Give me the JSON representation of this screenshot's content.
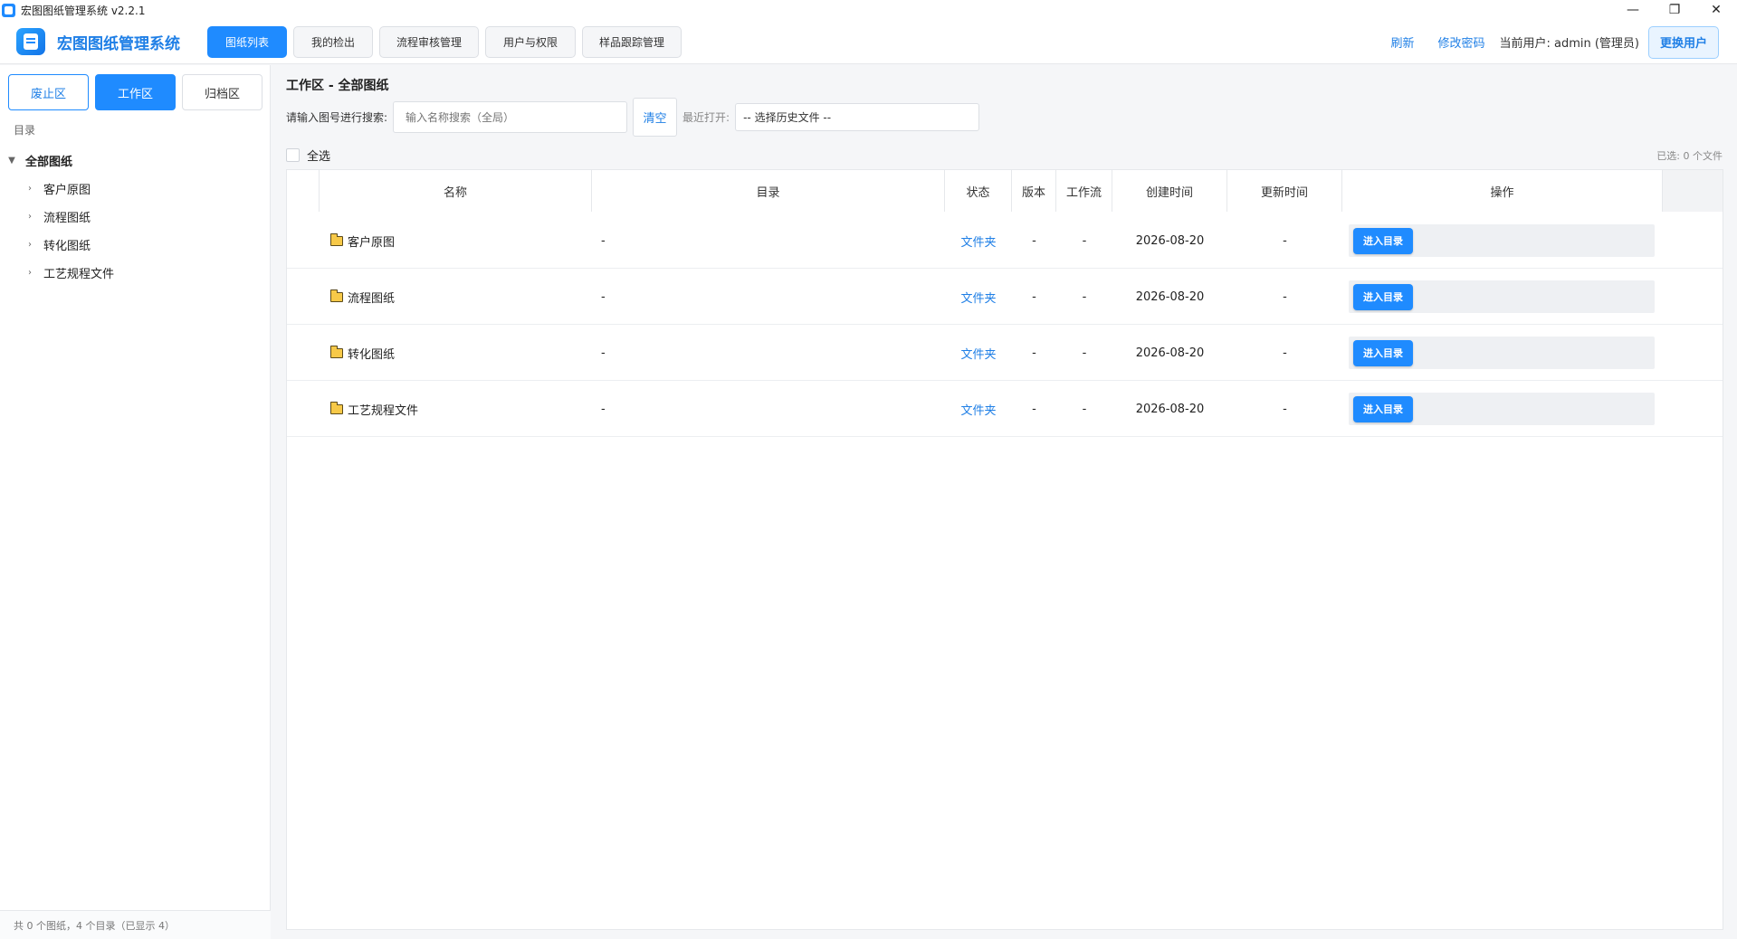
{
  "window": {
    "title": "宏图图纸管理系统  v2.2.1",
    "controls": {
      "minimize": "—",
      "restore": "❐",
      "close": "✕"
    }
  },
  "header": {
    "brand": "宏图图纸管理系统",
    "nav": [
      {
        "label": "图纸列表",
        "active": true
      },
      {
        "label": "我的检出",
        "active": false
      },
      {
        "label": "流程审核管理",
        "active": false
      },
      {
        "label": "用户与权限",
        "active": false
      },
      {
        "label": "样品跟踪管理",
        "active": false
      }
    ],
    "refresh": "刷新",
    "change_password": "修改密码",
    "current_user": "当前用户: admin (管理员)",
    "switch_user": "更换用户"
  },
  "sidebar": {
    "zones": [
      "废止区",
      "工作区",
      "归档区"
    ],
    "section_label": "目录",
    "tree": {
      "root": "全部图纸",
      "children": [
        "客户原图",
        "流程图纸",
        "转化图纸",
        "工艺规程文件"
      ]
    },
    "footer": "共 0 个图纸，4 个目录（已显示 4）"
  },
  "main": {
    "title": "工作区 - 全部图纸",
    "search_label": "请输入图号进行搜索:",
    "search_placeholder": "输入名称搜索（全局）",
    "clear": "清空",
    "recent_label": "最近打开:",
    "recent_value": "-- 选择历史文件 --",
    "select_all": "全选",
    "selected_count": "已选: 0 个文件",
    "columns": [
      "名称",
      "目录",
      "状态",
      "版本",
      "工作流",
      "创建时间",
      "更新时间",
      "操作"
    ],
    "rows": [
      {
        "name": "客户原图",
        "dir": "-",
        "status": "文件夹",
        "version": "-",
        "workflow": "-",
        "created": "2026-08-20",
        "updated": "-",
        "action": "进入目录"
      },
      {
        "name": "流程图纸",
        "dir": "-",
        "status": "文件夹",
        "version": "-",
        "workflow": "-",
        "created": "2026-08-20",
        "updated": "-",
        "action": "进入目录"
      },
      {
        "name": "转化图纸",
        "dir": "-",
        "status": "文件夹",
        "version": "-",
        "workflow": "-",
        "created": "2026-08-20",
        "updated": "-",
        "action": "进入目录"
      },
      {
        "name": "工艺规程文件",
        "dir": "-",
        "status": "文件夹",
        "version": "-",
        "workflow": "-",
        "created": "2026-08-20",
        "updated": "-",
        "action": "进入目录"
      }
    ]
  },
  "colors": {
    "accent": "#1f8bff",
    "link": "#1f7fe6",
    "folder": "#f7c948"
  }
}
